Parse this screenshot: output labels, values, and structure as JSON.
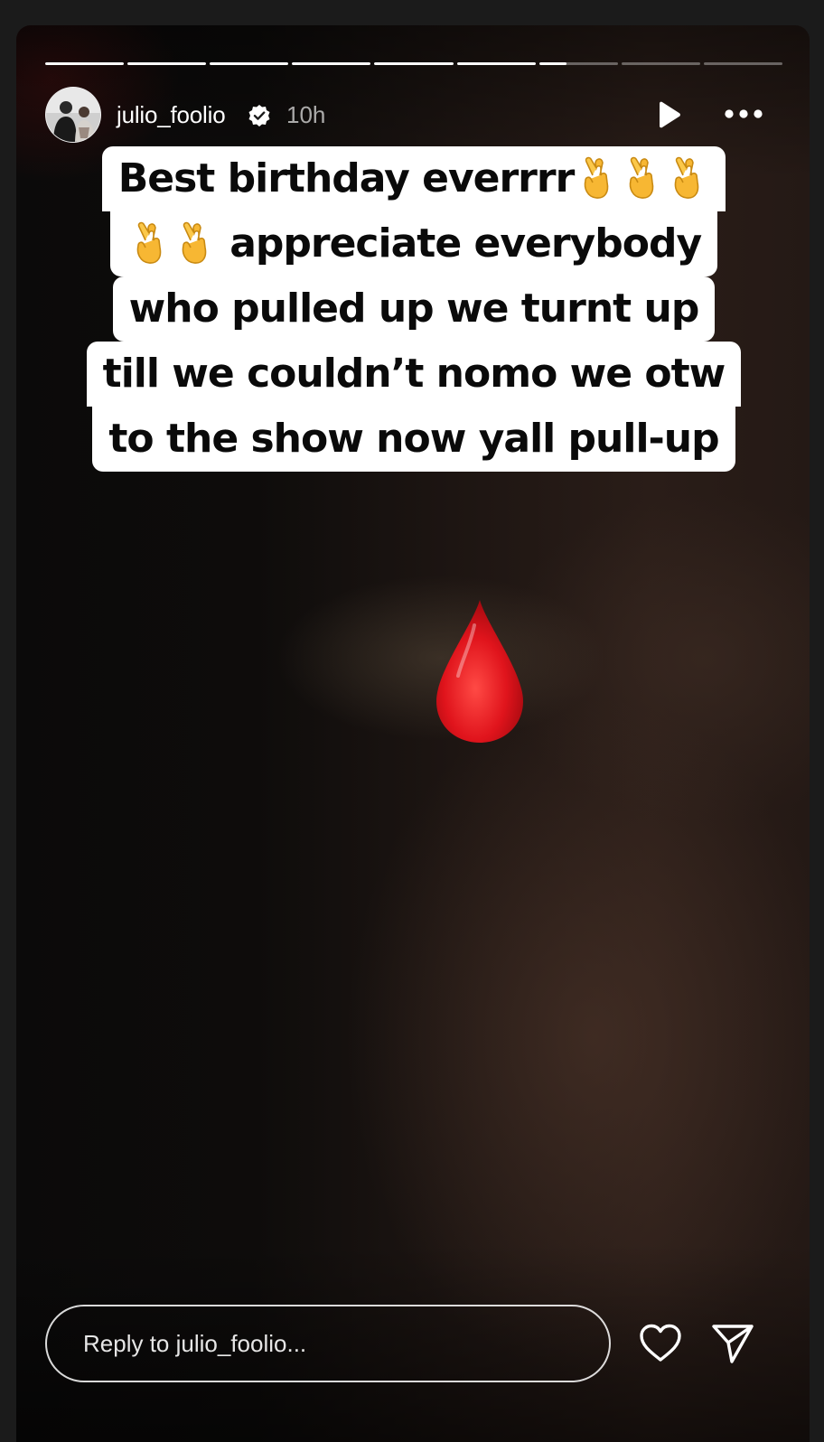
{
  "progress": {
    "segments": [
      1,
      1,
      1,
      1,
      1,
      1,
      0.35,
      0,
      0
    ]
  },
  "header": {
    "username": "julio_foolio",
    "verified": true,
    "time": "10h",
    "play_icon": "play-icon",
    "more_icon": "more-icon"
  },
  "caption": {
    "lines": [
      "Best birthday everrrr",
      "appreciate everybody",
      "who pulled up we turnt up",
      "till we couldn’t nomo we otw",
      "to the show now yall pull-up"
    ],
    "emoji": "🤞",
    "line1_emoji_count": 3,
    "line2_emoji_count": 2
  },
  "sticker": {
    "icon": "blood-drop-icon"
  },
  "footer": {
    "reply_placeholder": "Reply to julio_foolio...",
    "like_icon": "heart-icon",
    "share_icon": "send-icon"
  },
  "colors": {
    "caption_bg": "#ffffff",
    "caption_text": "#0a0a0a",
    "drop": "#e0141c"
  }
}
